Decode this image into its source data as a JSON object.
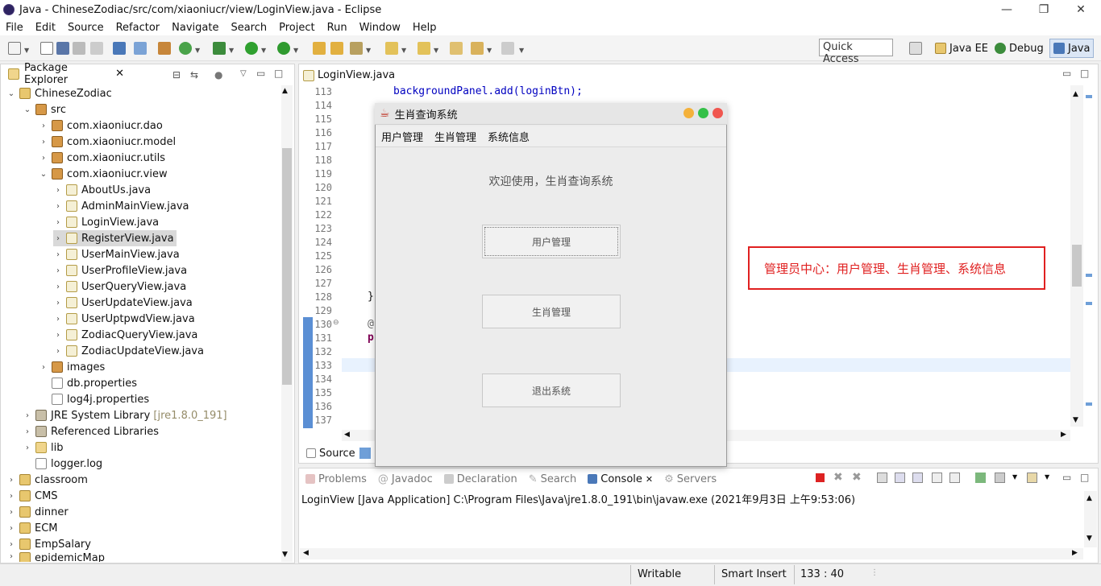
{
  "window": {
    "title": "Java - ChineseZodiac/src/com/xiaoniucr/view/LoginView.java - Eclipse"
  },
  "menubar": [
    "File",
    "Edit",
    "Source",
    "Refactor",
    "Navigate",
    "Search",
    "Project",
    "Run",
    "Window",
    "Help"
  ],
  "toolbar": {
    "quick_access": "Quick Access"
  },
  "perspectives": {
    "javaee": "Java EE",
    "debug": "Debug",
    "java": "Java"
  },
  "package_explorer": {
    "tab_label": "Package Explorer",
    "items": [
      {
        "label": "ChineseZodiac"
      },
      {
        "label": "src"
      },
      {
        "label": "com.xiaoniucr.dao"
      },
      {
        "label": "com.xiaoniucr.model"
      },
      {
        "label": "com.xiaoniucr.utils"
      },
      {
        "label": "com.xiaoniucr.view"
      },
      {
        "label": "AboutUs.java"
      },
      {
        "label": "AdminMainView.java"
      },
      {
        "label": "LoginView.java"
      },
      {
        "label": "RegisterView.java"
      },
      {
        "label": "UserMainView.java"
      },
      {
        "label": "UserProfileView.java"
      },
      {
        "label": "UserQueryView.java"
      },
      {
        "label": "UserUpdateView.java"
      },
      {
        "label": "UserUptpwdView.java"
      },
      {
        "label": "ZodiacQueryView.java"
      },
      {
        "label": "ZodiacUpdateView.java"
      },
      {
        "label": "images"
      },
      {
        "label": "db.properties"
      },
      {
        "label": "log4j.properties"
      },
      {
        "label": "JRE System Library",
        "suffix": "[jre1.8.0_191]"
      },
      {
        "label": "Referenced Libraries"
      },
      {
        "label": "lib"
      },
      {
        "label": "logger.log"
      },
      {
        "label": "classroom"
      },
      {
        "label": "CMS"
      },
      {
        "label": "dinner"
      },
      {
        "label": "ECM"
      },
      {
        "label": "EmpSalary"
      },
      {
        "label": "epidemicMap"
      }
    ]
  },
  "editor": {
    "tab_label": "LoginView.java",
    "line_numbers": [
      "113",
      "114",
      "115",
      "116",
      "117",
      "118",
      "119",
      "120",
      "121",
      "122",
      "123",
      "124",
      "125",
      "126",
      "127",
      "128",
      "129",
      "130",
      "131",
      "132",
      "133",
      "134",
      "135",
      "136",
      "137"
    ],
    "code_line_113": "backgroundPanel.add(loginBtn);",
    "code_line_128": "}",
    "code_line_130": "@",
    "code_line_131": "p",
    "bottom_tab": "Source"
  },
  "annotation": "管理员中心：用户管理、生肖管理、系统信息",
  "dialog": {
    "title": "生肖查询系统",
    "menu": [
      "用户管理",
      "生肖管理",
      "系统信息"
    ],
    "welcome": "欢迎使用，生肖查询系统",
    "btn_user": "用户管理",
    "btn_zodiac": "生肖管理",
    "btn_exit": "退出系统"
  },
  "console": {
    "tabs": [
      "Problems",
      "Javadoc",
      "Declaration",
      "Search",
      "Console",
      "Servers"
    ],
    "launch": "LoginView [Java Application] C:\\Program Files\\Java\\jre1.8.0_191\\bin\\javaw.exe (2021年9月3日 上午9:53:06)"
  },
  "status": {
    "writable": "Writable",
    "insert": "Smart Insert",
    "position": "133 : 40"
  }
}
